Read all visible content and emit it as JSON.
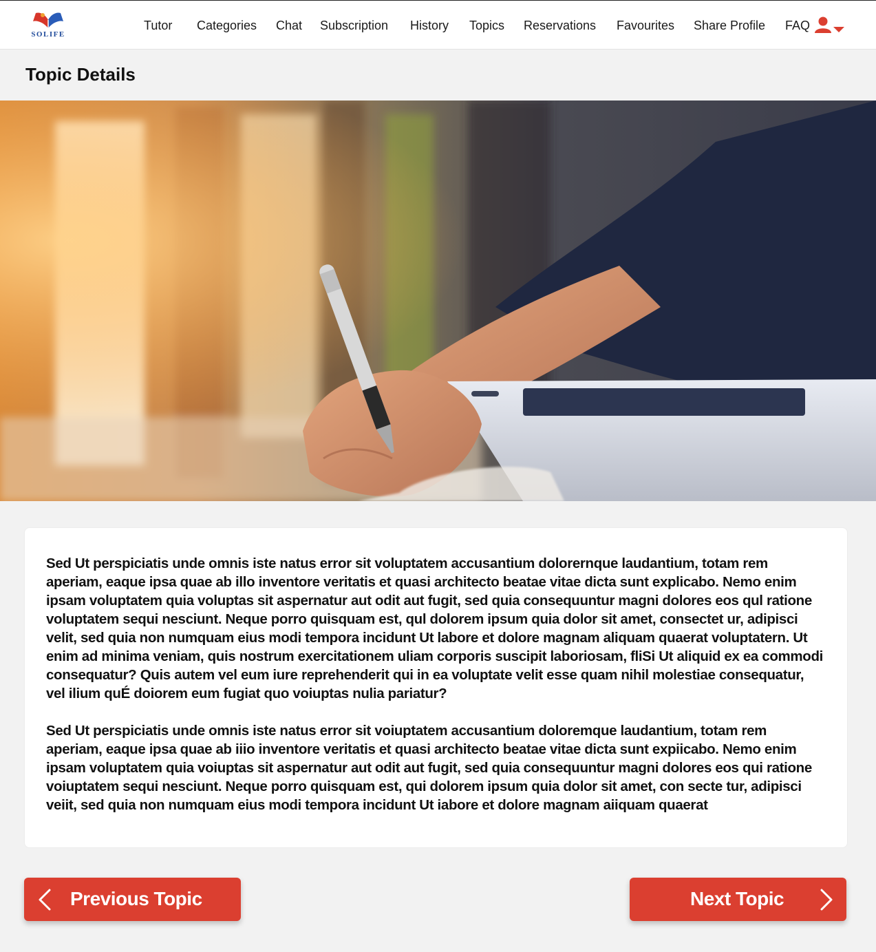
{
  "app": {
    "logo_text": "SOLIFE"
  },
  "nav": {
    "items": [
      {
        "label": "Tutor"
      },
      {
        "label": "Categories"
      },
      {
        "label": "Chat"
      },
      {
        "label": "Subscription"
      },
      {
        "label": "History"
      },
      {
        "label": "Topics"
      },
      {
        "label": "Reservations"
      },
      {
        "label": "Favourites"
      },
      {
        "label": "Share Profile"
      },
      {
        "label": "FAQ"
      }
    ],
    "profile_icon": "user-icon",
    "dropdown_icon": "caret-down-icon"
  },
  "page": {
    "title": "Topic Details"
  },
  "hero": {
    "image": "hand-writing-with-pen-and-tablet-photo"
  },
  "content": {
    "paragraphs": [
      "Sed Ut perspiciatis unde omnis iste natus error sit voluptatem accusantium dolorernque laudantium, totam rem aperiam, eaque ipsa quae ab illo inventore veritatis et quasi architecto beatae vitae dicta sunt explicabo. Nemo enim ipsam voluptatem quia voluptas sit aspernatur aut odit aut fugit, sed quia consequuntur magni dolores eos qul ratione voluptatem sequi nesciunt. Neque porro quisquam est, qul dolorem ipsum quia dolor sit amet, consectet ur, adipisci velit, sed quia non numquam eius modi tempora incidunt Ut labore et dolore magnam aliquam quaerat voluptatern. Ut enim ad minima veniam, quis nostrum exercitationem uliam corporis suscipit laboriosam, fliSi Ut aliquid ex ea commodi consequatur? Quis autem vel eum iure reprehenderit qui in ea voluptate velit esse quam nihil molestiae consequatur, vel ilium quÉ doiorem eum fugiat quo voiuptas nulia pariatur?",
      "Sed Ut perspiciatis unde omnis iste natus error sit voiuptatem accusantium doloremque laudantium, totam rem aperiam, eaque ipsa quae ab iiio inventore veritatis et quasi architecto beatae vitae dicta sunt expiicabo. Nemo enim ipsam voluptatem quia voiuptas sit aspernatur aut odit aut fugit, sed quia consequuntur magni dolores eos qui ratione voiuptatem sequi nesciunt. Neque porro quisquam est, qui dolorem ipsum quia dolor sit amet, con secte tur, adipisci veiit, sed quia non numquam eius modi tempora incidunt Ut iabore et dolore magnam aiiquam quaerat"
    ]
  },
  "pager": {
    "prev_label": "Previous Topic",
    "next_label": "Next Topic",
    "prev_icon": "chevron-left-icon",
    "next_icon": "chevron-right-icon"
  },
  "colors": {
    "accent": "#db3f30",
    "logo_blue": "#1f4a9a",
    "background": "#f2f2f2"
  }
}
